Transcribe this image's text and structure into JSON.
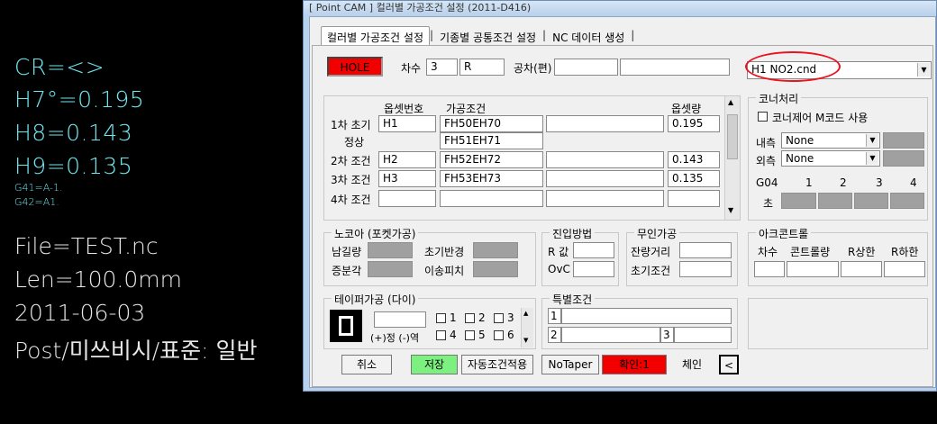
{
  "cad": {
    "cr": "CR=<>",
    "h7": "H7°=0.195",
    "h8": "H8=0.143",
    "h9": "H9=0.135",
    "g41": "G41=A-1.",
    "g42": "G42=A1.",
    "file": "File=TEST.nc",
    "len": "Len=100.0mm",
    "date": "2011-06-03",
    "post": "Post/미쓰비시/표준: 일반"
  },
  "window": {
    "title": "[ Point CAM ]  컬러별 가공조건 설정  (2011-D416)"
  },
  "tabs": [
    "컬러별 가공조건 설정",
    "기종별 공통조건 설정",
    "NC 데이터 생성"
  ],
  "top": {
    "hole_label": "HOLE",
    "chasu_label": "차수",
    "chasu_value": "3",
    "chasu_r": "R",
    "gongcha_label": "공차(편)",
    "file_select": "H1 NO2.cnd"
  },
  "table": {
    "col_offset_no": "옵셋번호",
    "col_condition": "가공조건",
    "col_offset_amt": "옵셋량",
    "rows": [
      {
        "label": "1차 초기",
        "offset_no": "H1",
        "condition": "FH50EH70",
        "amount": "0.195"
      },
      {
        "label": "정상",
        "offset_no": "",
        "condition": "FH51EH71",
        "amount": ""
      },
      {
        "label": "2차 조건",
        "offset_no": "H2",
        "condition": "FH52EH72",
        "amount": "0.143"
      },
      {
        "label": "3차 조건",
        "offset_no": "H3",
        "condition": "FH53EH73",
        "amount": "0.135"
      },
      {
        "label": "4차 조건",
        "offset_no": "",
        "condition": "",
        "amount": ""
      }
    ]
  },
  "corner": {
    "title": "코너처리",
    "mcode_label": "코너제어 M코드 사용",
    "inner_label": "내측",
    "inner_value": "None",
    "outer_label": "외측",
    "outer_value": "None",
    "g04_label": "G04",
    "g04_cols": [
      "1",
      "2",
      "3",
      "4"
    ],
    "sec_label": "초"
  },
  "nocore": {
    "title": "노코아 (포켓가공)",
    "remain_len": "남길량",
    "init_radius": "초기반경",
    "incr_angle": "증분각",
    "move_pitch": "이송피치"
  },
  "approach": {
    "title": "진입방법",
    "r_label": "R 값",
    "ovc_label": "OvC"
  },
  "unmanned": {
    "title": "무인가공",
    "remain_dist": "잔량거리",
    "init_cond": "초기조건"
  },
  "arc": {
    "title": "아크콘트롤",
    "cols": [
      "차수",
      "콘트롤량",
      "R상한",
      "R하한"
    ]
  },
  "taper": {
    "title": "테이퍼가공 (다이)",
    "sign_label": "(+)정 (-)역",
    "checks": [
      "1",
      "2",
      "3",
      "4",
      "5",
      "6"
    ]
  },
  "special": {
    "title": "특별조건",
    "n1": "1",
    "n2": "2",
    "n3": "3"
  },
  "buttons": {
    "cancel": "취소",
    "save": "저장",
    "auto_apply": "자동조건적용",
    "no_taper": "NoTaper",
    "confirm": "확인:1",
    "change": "체인",
    "back": "<"
  }
}
